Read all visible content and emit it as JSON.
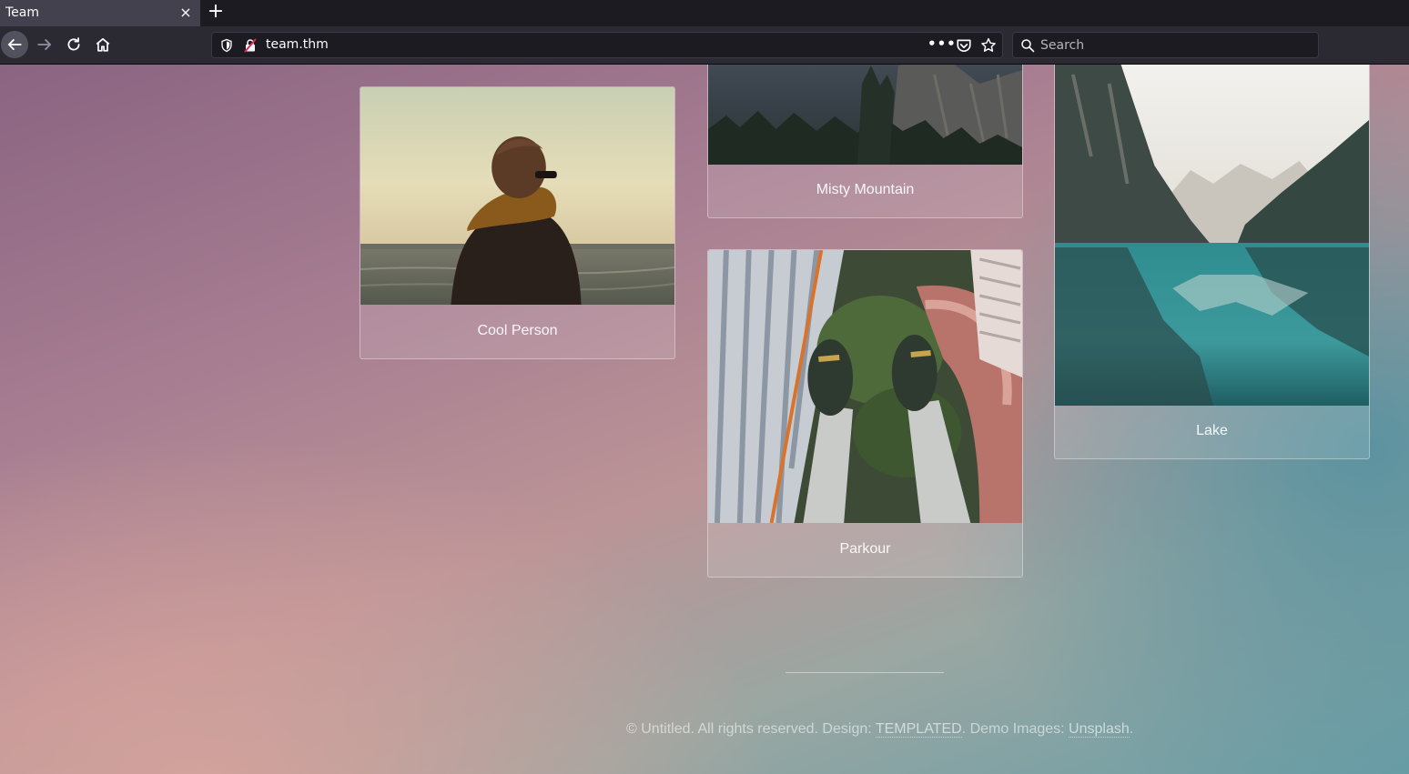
{
  "browser": {
    "tab_title": "Team",
    "tab_close": "×",
    "new_tab": "+",
    "url": "team.thm",
    "url_actions": "•••",
    "search_placeholder": "Search"
  },
  "gallery": {
    "cards": [
      {
        "label": "Cool Person",
        "image": "person-by-the-sea"
      },
      {
        "label": "Misty Mountain",
        "image": "forest-mountain"
      },
      {
        "label": "Parkour",
        "image": "feet-above-skyscrapers"
      },
      {
        "label": "Lake",
        "image": "mountain-lake-reflection"
      }
    ]
  },
  "footer": {
    "copyright": "© Untitled. All rights reserved. Design: ",
    "design_link": "TEMPLATED",
    "images_text": ". Demo Images: ",
    "images_link": "Unsplash",
    "end": "."
  },
  "colors": {
    "chrome_dark": "#1c1b22",
    "toolbar": "#2b2a33",
    "active_tab": "#42414d"
  }
}
